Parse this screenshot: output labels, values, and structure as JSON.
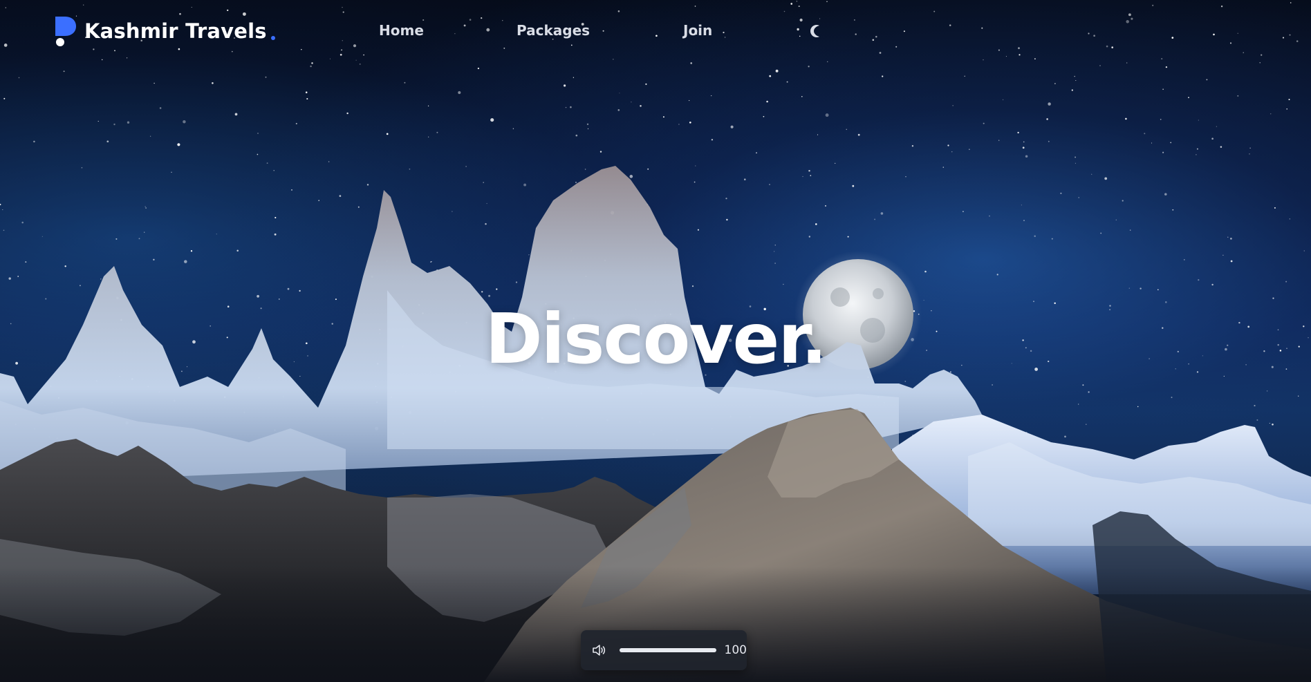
{
  "brand": {
    "name": "Kashmir Travels"
  },
  "nav": {
    "links": [
      {
        "label": "Home"
      },
      {
        "label": "Packages"
      },
      {
        "label": "Join"
      }
    ],
    "theme_icon": "moon-icon"
  },
  "hero": {
    "title": "Discover."
  },
  "player": {
    "volume_icon": "speaker-icon",
    "volume": 100,
    "volume_label": "100"
  },
  "colors": {
    "brand_accent": "#3b6fff",
    "text_primary": "#ffffff",
    "nav_text": "#d9dde6",
    "player_bg": "#20242c"
  }
}
